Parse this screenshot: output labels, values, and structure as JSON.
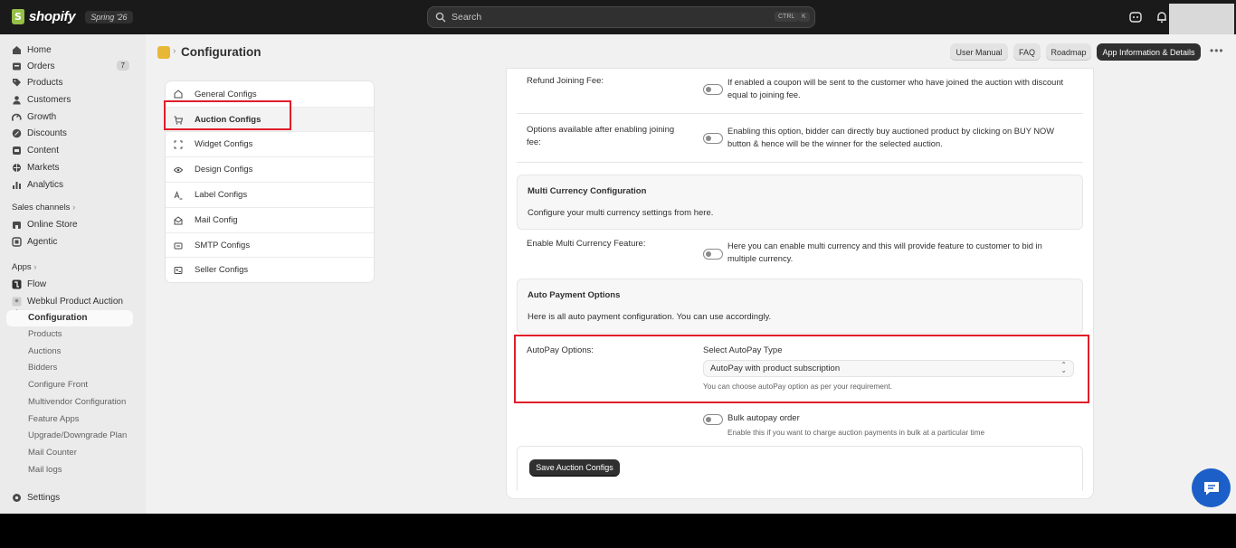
{
  "topbar": {
    "brand": "shopify",
    "version": "Spring '26",
    "search_placeholder": "Search",
    "shortcut_ctrl": "CTRL",
    "shortcut_key": "K"
  },
  "sidebar": {
    "primary": [
      {
        "label": "Home",
        "icon": "home-icon"
      },
      {
        "label": "Orders",
        "icon": "orders-icon",
        "badge": "7"
      },
      {
        "label": "Products",
        "icon": "tag-icon"
      },
      {
        "label": "Customers",
        "icon": "person-icon"
      },
      {
        "label": "Growth",
        "icon": "growth-icon"
      },
      {
        "label": "Discounts",
        "icon": "discount-icon"
      },
      {
        "label": "Content",
        "icon": "content-icon"
      },
      {
        "label": "Markets",
        "icon": "globe-icon"
      },
      {
        "label": "Analytics",
        "icon": "bar-chart-icon"
      }
    ],
    "sales_channels_label": "Sales channels",
    "sales_channels": [
      {
        "label": "Online Store",
        "icon": "store-icon"
      },
      {
        "label": "Agentic",
        "icon": "agentic-icon"
      }
    ],
    "apps_label": "Apps",
    "apps": [
      {
        "label": "Flow",
        "icon": "flow-icon"
      },
      {
        "label": "Webkul Product Auction",
        "icon": "app-icon"
      }
    ],
    "app_sub_active": "Configuration",
    "app_sub": [
      "Products",
      "Auctions",
      "Bidders",
      "Configure Front",
      "Multivendor Configuration",
      "Feature Apps",
      "Upgrade/Downgrade Plan",
      "Mail Counter",
      "Mail logs"
    ],
    "settings_label": "Settings"
  },
  "header": {
    "title": "Configuration",
    "buttons": [
      "User Manual",
      "FAQ",
      "Roadmap",
      "App Information & Details"
    ],
    "more": "•••"
  },
  "config_menu": [
    {
      "label": "General Configs",
      "icon": "home-outline-icon"
    },
    {
      "label": "Auction Configs",
      "icon": "cart-icon"
    },
    {
      "label": "Widget Configs",
      "icon": "frame-icon"
    },
    {
      "label": "Design Configs",
      "icon": "eye-icon"
    },
    {
      "label": "Label Configs",
      "icon": "text-icon"
    },
    {
      "label": "Mail Config",
      "icon": "mail-icon"
    },
    {
      "label": "SMTP Configs",
      "icon": "mail-box-icon"
    },
    {
      "label": "Seller Configs",
      "icon": "seller-icon"
    }
  ],
  "settings": {
    "refund_label": "Refund Joining Fee:",
    "refund_desc": "If enabled a coupon will be sent to the customer who have joined the auction with discount equal to joining fee.",
    "options_label": "Options available after enabling joining fee:",
    "options_desc": "Enabling this option, bidder can directly buy auctioned product by clicking on BUY NOW button & hence will be the winner for the selected auction.",
    "multi_title": "Multi Currency Configuration",
    "multi_sub": "Configure your multi currency settings from here.",
    "multi_label": "Enable Multi Currency Feature:",
    "multi_desc": "Here you can enable multi currency and this will provide feature to customer to bid in multiple currency.",
    "auto_title": "Auto Payment Options",
    "auto_sub": "Here is all auto payment configuration. You can use accordingly.",
    "autopay_label": "AutoPay Options:",
    "autopay_select_label": "Select AutoPay Type",
    "autopay_value": "AutoPay with product subscription",
    "autopay_help": "You can choose autoPay option as per your requirement.",
    "bulk_label": "Bulk autopay order",
    "bulk_desc": "Enable this if you want to charge auction payments in bulk at a particular time",
    "save_label": "Save Auction Configs"
  }
}
